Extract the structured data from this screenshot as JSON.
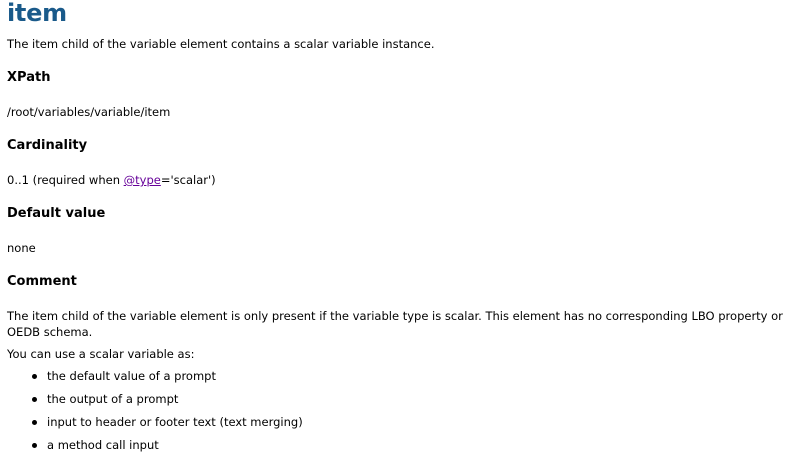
{
  "title": "item",
  "intro": "The item child of the variable element contains a scalar variable instance.",
  "sections": {
    "xpath": {
      "heading": "XPath",
      "text": "/root/variables/variable/item"
    },
    "cardinality": {
      "heading": "Cardinality",
      "text_before": "0..1 (required when ",
      "link": "@type",
      "text_after": "='scalar')"
    },
    "default_value": {
      "heading": "Default value",
      "text": "none"
    },
    "comment": {
      "heading": "Comment",
      "text": "The item child of the variable element is only present if the variable type is scalar. This element has no corresponding LBO property or OEDB schema.",
      "usage_intro": "You can use a scalar variable as:",
      "items": [
        "the default value of a prompt",
        "the output of a prompt",
        "input to header or footer text (text merging)",
        "a method call input"
      ]
    }
  }
}
